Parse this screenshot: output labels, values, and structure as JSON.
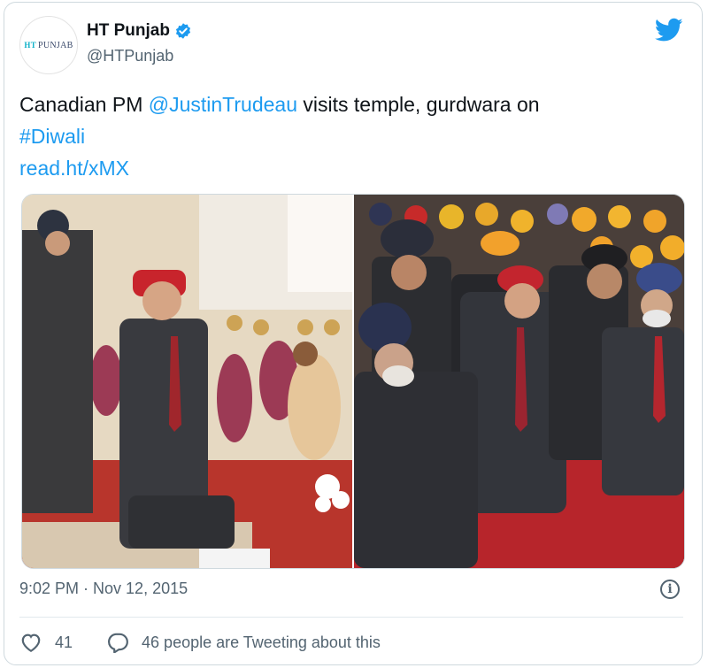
{
  "tweet": {
    "avatar_text": "PUNJAB",
    "avatar_prefix": "HT",
    "display_name": "HT Punjab",
    "handle": "@HTPunjab",
    "text_part1": "Canadian PM ",
    "mention": "@JustinTrudeau",
    "text_part2": " visits temple, gurdwara on",
    "hashtag": "#Diwali",
    "short_link": "read.ht/xMX",
    "timestamp": "9:02 PM · Nov 12, 2015",
    "likes": "41",
    "replies_text": "46 people are Tweeting about this"
  },
  "colors": {
    "accent": "#1d9bf0",
    "text": "#0f1419",
    "muted": "#536471",
    "border": "#cfd9de"
  },
  "icons": [
    "twitter-bird-icon",
    "verified-badge-icon",
    "info-icon",
    "heart-icon",
    "speech-bubble-icon"
  ]
}
